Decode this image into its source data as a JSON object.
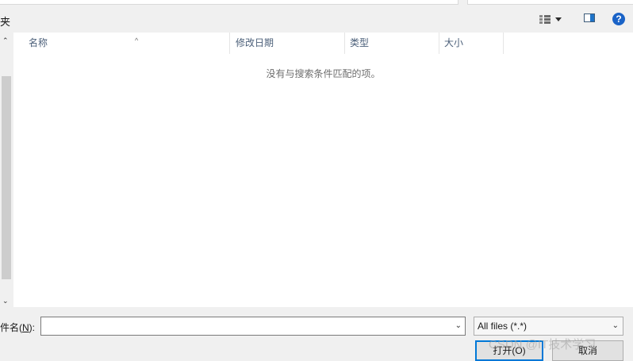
{
  "breadcrumb": {
    "text": "夹"
  },
  "toolbar": {
    "view_icon": "details-view-icon",
    "view_caret": "chevron-down-icon",
    "preview_icon": "preview-pane-icon",
    "help_icon": "help-icon",
    "help_label": "?"
  },
  "nav": {
    "scroll_up": "⌃",
    "scroll_down": "⌄"
  },
  "columns": {
    "name": "名称",
    "modified": "修改日期",
    "type": "类型",
    "size": "大小",
    "sort_indicator": "^"
  },
  "empty_message": "没有与搜索条件匹配的项。",
  "filename": {
    "label_prefix": "件名(",
    "label_accel": "N",
    "label_suffix": "):",
    "value": "",
    "dropdown": "⌄"
  },
  "filter": {
    "selected": "All files (*.*)",
    "dropdown": "⌄"
  },
  "buttons": {
    "open": "打开(O)",
    "cancel": "取消"
  },
  "watermark": "CSDN @IT技术学习",
  "colors": {
    "accent": "#0078d7",
    "help": "#1a63c7",
    "header_text": "#4c607a"
  }
}
